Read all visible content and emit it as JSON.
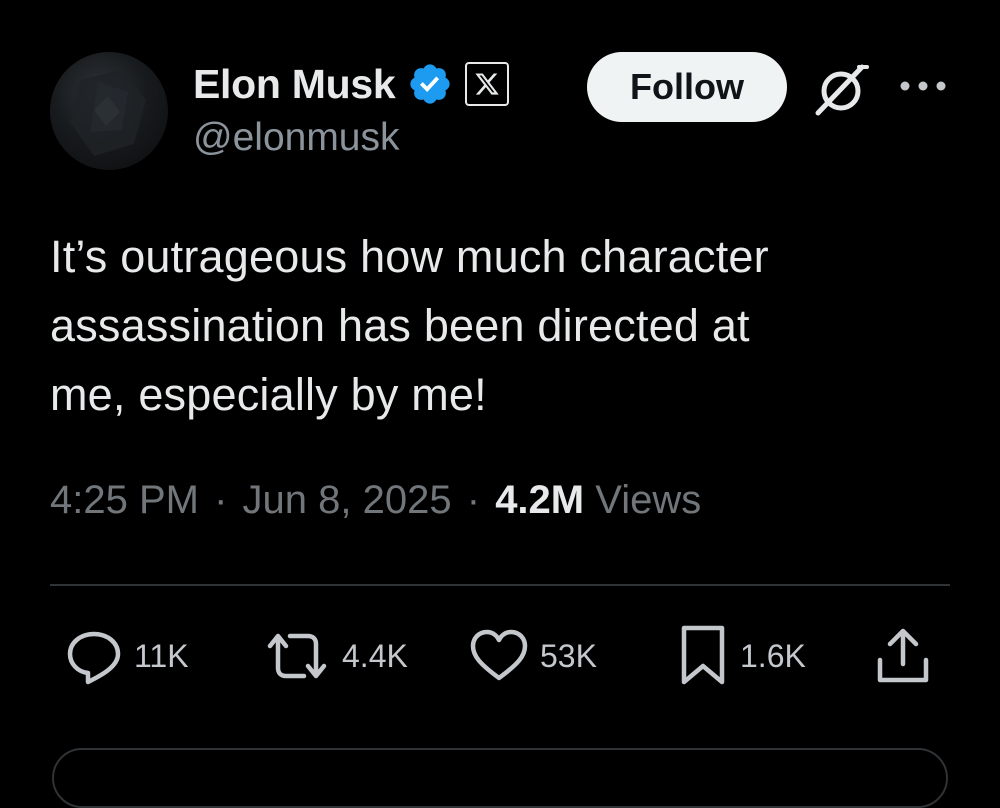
{
  "author": {
    "display_name": "Elon Musk",
    "handle": "@elonmusk",
    "verified": true,
    "verified_color": "#1d9bf0",
    "affiliate_badge_icon": "x-logo-icon"
  },
  "header": {
    "follow_label": "Follow",
    "grok_icon": "grok-icon",
    "more_icon": "more-options-icon"
  },
  "tweet": {
    "text_lines": [
      "It’s outrageous how much character",
      "assassination has been directed at",
      "me, especially by me!"
    ],
    "time": "4:25 PM",
    "separator": "·",
    "date": "Jun 8, 2025",
    "views_count": "4.2M",
    "views_label": "Views"
  },
  "actions": {
    "replies": "11K",
    "reposts": "4.4K",
    "likes": "53K",
    "bookmarks": "1.6K"
  },
  "colors": {
    "background": "#000000",
    "text": "#e7e9ea",
    "secondary_text": "#71767b",
    "divider": "#2f3336",
    "follow_button_bg": "#eff3f4"
  }
}
